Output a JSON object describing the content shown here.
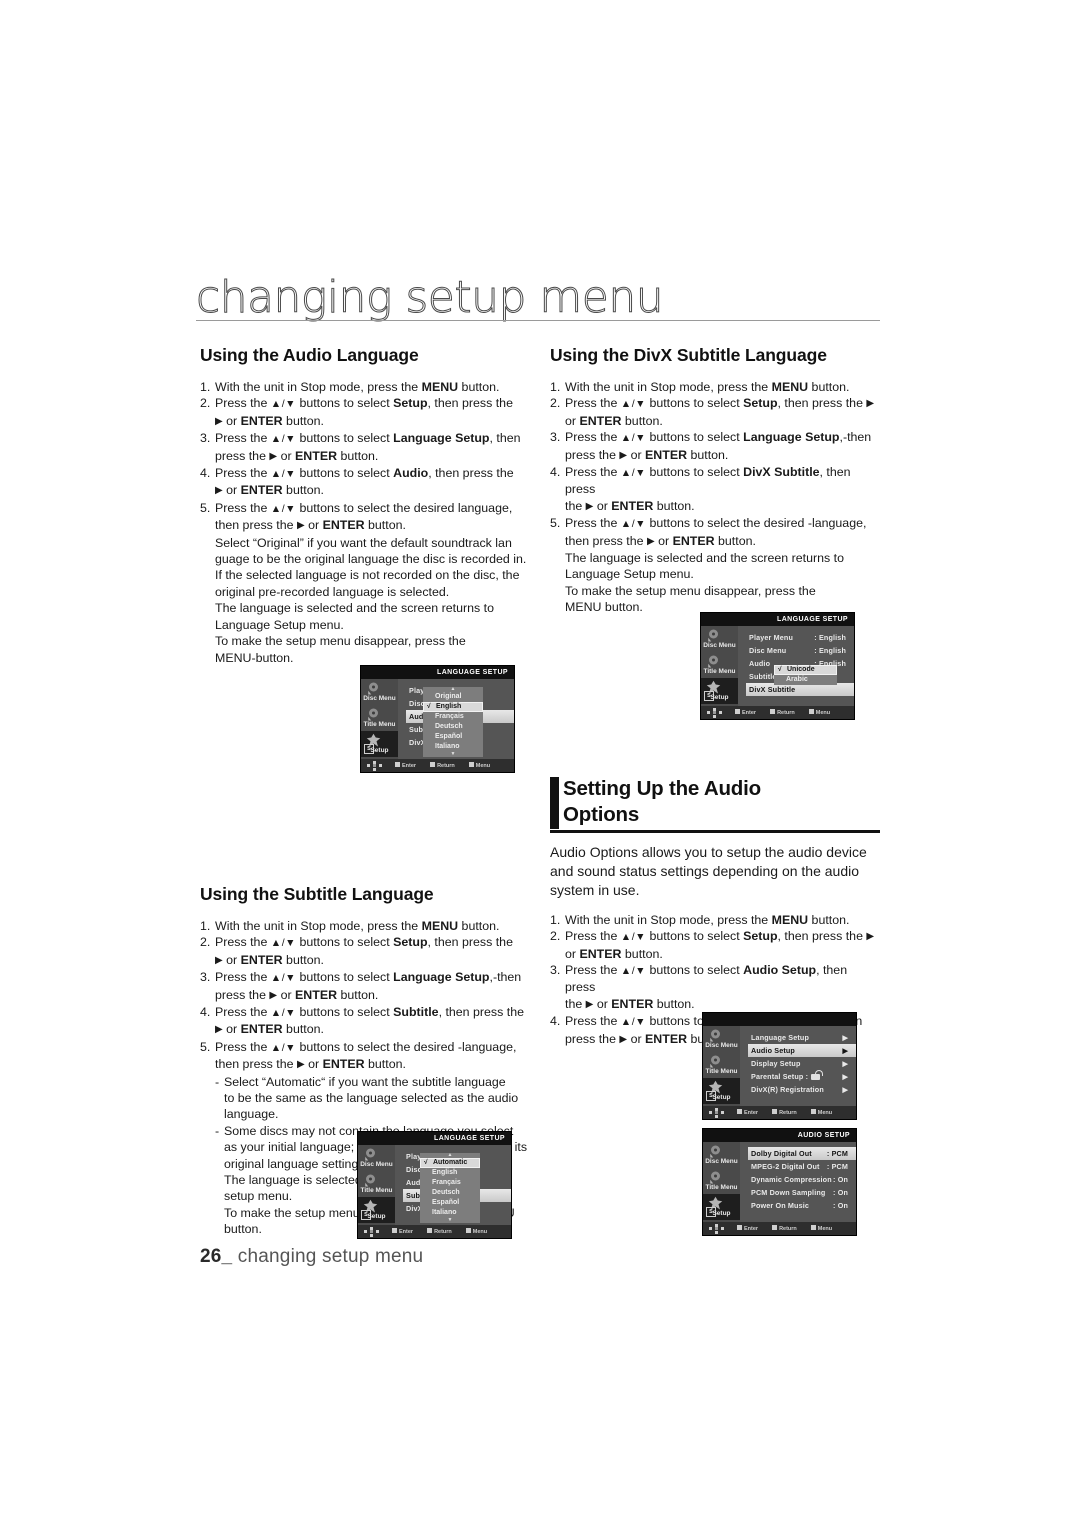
{
  "page": {
    "title": "changing setup menu",
    "footer_number": "26_",
    "footer_text": "changing setup menu"
  },
  "sections": {
    "audio_language": {
      "heading": "Using the Audio Language",
      "steps": [
        {
          "num": "1.",
          "html": "With the unit in Stop mode, press the <b>MENU</b> button."
        },
        {
          "num": "2.",
          "html": "Press the <span class=\"ud\">▲/▼</span> buttons to select <b>Setup</b>, then press the"
        },
        {
          "num": "",
          "cont": true,
          "html": "<span class=\"arr\">▶</span> or <b>ENTER</b> button."
        },
        {
          "num": "3.",
          "html": "Press the <span class=\"ud\">▲/▼</span> buttons to select <b>Language Setup</b>, then"
        },
        {
          "num": "",
          "cont": true,
          "html": "press the <span class=\"arr\">▶</span> or <b>ENTER</b> button."
        },
        {
          "num": "4.",
          "html": "Press the <span class=\"ud\">▲/▼</span> buttons to select <b>Audio</b>, then press the"
        },
        {
          "num": "",
          "cont": true,
          "html": "<span class=\"arr\">▶</span> or <b>ENTER</b> button."
        },
        {
          "num": "5.",
          "html": "Press the <span class=\"ud\">▲/▼</span> buttons to select the desired language,"
        },
        {
          "num": "",
          "cont": true,
          "html": "then press the <span class=\"arr\">▶</span> or <b>ENTER</b> button."
        },
        {
          "num": "",
          "cont": true,
          "html": "Select “Original” if you want the default soundtrack lan"
        },
        {
          "num": "",
          "cont": true,
          "html": "guage to be the original language the disc is recorded in."
        },
        {
          "num": "",
          "cont": true,
          "html": "If the selected language is not recorded on the disc, the"
        },
        {
          "num": "",
          "cont": true,
          "html": "original pre-recorded language is selected."
        },
        {
          "num": "",
          "cont": true,
          "html": "The language is selected and the screen returns to"
        },
        {
          "num": "",
          "cont": true,
          "html": "Language Setup menu."
        },
        {
          "num": "",
          "cont": true,
          "html": "To make the setup menu disappear, press the"
        },
        {
          "num": "",
          "cont": true,
          "html": "MENU-button."
        }
      ]
    },
    "subtitle_language": {
      "heading": "Using the Subtitle Language",
      "steps": [
        {
          "num": "1.",
          "html": "With the unit in Stop mode, press the <b>MENU</b> button."
        },
        {
          "num": "2.",
          "html": "Press the <span class=\"ud\">▲/▼</span> buttons to select <b>Setup</b>, then press the"
        },
        {
          "num": "",
          "cont": true,
          "html": "<span class=\"arr\">▶</span> or <b>ENTER</b> button."
        },
        {
          "num": "3.",
          "html": "Press the <span class=\"ud\">▲/▼</span> buttons to select <b>Language Setup</b>,-then"
        },
        {
          "num": "",
          "cont": true,
          "html": "press the <span class=\"arr\">▶</span> or <b>ENTER</b> button."
        },
        {
          "num": "4.",
          "html": "Press the <span class=\"ud\">▲/▼</span> buttons to select <b>Subtitle</b>, then press the"
        },
        {
          "num": "",
          "cont": true,
          "html": "<span class=\"arr\">▶</span> or <b>ENTER</b> button."
        },
        {
          "num": "5.",
          "html": "Press the <span class=\"ud\">▲/▼</span> buttons to select the desired -language,"
        },
        {
          "num": "",
          "cont": true,
          "html": "then press the <span class=\"arr\">▶</span> or <b>ENTER</b> button."
        },
        {
          "num": "-",
          "dash": true,
          "html": "Select “Automatic“ if you want the subtitle  language"
        },
        {
          "num": "",
          "cont2": true,
          "html": "to be the same as the language selected as the audio"
        },
        {
          "num": "",
          "cont2": true,
          "html": "language."
        },
        {
          "num": "-",
          "dash": true,
          "html": "Some discs may not contain the language you select"
        },
        {
          "num": "",
          "cont2": true,
          "html": "as your initial language; in that case the disc will use its"
        },
        {
          "num": "",
          "cont2": true,
          "html": "original language setting."
        },
        {
          "num": "",
          "cont2": true,
          "html": "The language is selected and the screen returns to"
        },
        {
          "num": "",
          "cont2": true,
          "html": "setup menu."
        },
        {
          "num": "",
          "cont2": true,
          "html": "To make the setup menu disappear, press the MENU"
        },
        {
          "num": "",
          "cont2": true,
          "html": "button."
        }
      ]
    },
    "divx_subtitle_language": {
      "heading": "Using the DivX Subtitle Language",
      "steps": [
        {
          "num": "1.",
          "html": "With the unit in Stop mode, press the <b>MENU</b> button."
        },
        {
          "num": "2.",
          "html": "Press the <span class=\"ud\">▲/▼</span> buttons to select <b>Setup</b>, then press the <span class=\"arr\">▶</span>"
        },
        {
          "num": "",
          "cont": true,
          "html": "or <b>ENTER</b> button."
        },
        {
          "num": "3.",
          "html": "Press the <span class=\"ud\">▲/▼</span> buttons to select <b>Language Setup</b>,-then"
        },
        {
          "num": "",
          "cont": true,
          "html": "press the <span class=\"arr\">▶</span> or <b>ENTER</b> button."
        },
        {
          "num": "4.",
          "html": "Press the <span class=\"ud\">▲/▼</span> buttons to select <b>DivX Subtitle</b>, then press"
        },
        {
          "num": "",
          "cont": true,
          "html": "the <span class=\"arr\">▶</span> or <b>ENTER</b> button."
        },
        {
          "num": "5.",
          "html": "Press the <span class=\"ud\">▲/▼</span> buttons to select the desired -language,"
        },
        {
          "num": "",
          "cont": true,
          "html": "then press the <span class=\"arr\">▶</span> or <b>ENTER</b> button."
        },
        {
          "num": "",
          "cont": true,
          "html": "The language is selected and the screen returns to"
        },
        {
          "num": "",
          "cont": true,
          "html": "Language Setup menu."
        },
        {
          "num": "",
          "cont": true,
          "html": "To make the setup menu disappear, press the"
        },
        {
          "num": "",
          "cont": true,
          "html": "MENU button."
        }
      ]
    },
    "audio_options": {
      "heading_line1": "Setting Up the Audio",
      "heading_line2": "Options",
      "intro": "Audio Options allows you to setup the audio device and sound status settings depending on the audio system in use.",
      "steps": [
        {
          "num": "1.",
          "html": "With the unit in Stop mode, press the <b>MENU</b> button."
        },
        {
          "num": "2.",
          "html": "Press the <span class=\"ud\">▲/▼</span> buttons to select <b>Setup</b>, then press the <span class=\"arr\">▶</span>"
        },
        {
          "num": "",
          "cont": true,
          "html": "or <b>ENTER</b> button."
        },
        {
          "num": "3.",
          "html": "Press the <span class=\"ud\">▲/▼</span> buttons to select <b>Audio Setup</b>, then press"
        },
        {
          "num": "",
          "cont": true,
          "html": "the <span class=\"arr\">▶</span> or <b>ENTER</b> button."
        },
        {
          "num": "4.",
          "html": "Press the <span class=\"ud\">▲/▼</span> buttons to select the desired item, then"
        },
        {
          "num": "",
          "cont": true,
          "html": "press the <span class=\"arr\">▶</span> or <b>ENTER</b> button."
        }
      ]
    }
  },
  "osd_common": {
    "sidebar": [
      {
        "label": "Disc Menu",
        "icon": "disc-menu-icon"
      },
      {
        "label": "Title Menu",
        "icon": "title-menu-icon"
      },
      {
        "label": "Setup",
        "icon": "setup-icon",
        "badge": "S"
      }
    ],
    "footer": [
      {
        "label": "Enter"
      },
      {
        "label": "Return"
      },
      {
        "label": "Menu"
      }
    ]
  },
  "osd_screens": {
    "audio_language": {
      "title": "LANGUAGE SETUP",
      "rows": [
        {
          "name": "Player Menu",
          "value": "",
          "selected": false
        },
        {
          "name": "Disc Menu",
          "value": "",
          "selected": false
        },
        {
          "name": "Audio",
          "value": "",
          "selected": true
        },
        {
          "name": "Subtitle",
          "value": "",
          "selected": false
        },
        {
          "name": "DivX Subtitle",
          "value": "",
          "selected": false
        }
      ],
      "popup": {
        "up_arrow": "▲",
        "down_arrow": "▼",
        "items": [
          {
            "label": "Original",
            "checked": false,
            "selected": false
          },
          {
            "label": "English",
            "checked": true,
            "selected": true
          },
          {
            "label": "Français",
            "checked": false,
            "selected": false
          },
          {
            "label": "Deutsch",
            "checked": false,
            "selected": false
          },
          {
            "label": "Español",
            "checked": false,
            "selected": false
          },
          {
            "label": "Italiano",
            "checked": false,
            "selected": false
          }
        ]
      }
    },
    "divx_subtitle": {
      "title": "LANGUAGE SETUP",
      "rows": [
        {
          "name": "Player Menu",
          "value": ": English",
          "selected": false
        },
        {
          "name": "Disc Menu",
          "value": ": English",
          "selected": false
        },
        {
          "name": "Audio",
          "value": ": English",
          "selected": false
        },
        {
          "name": "Subtitle",
          "value": "",
          "selected": false
        },
        {
          "name": "DivX Subtitle",
          "value": "",
          "selected": true
        }
      ],
      "popup": {
        "items": [
          {
            "label": "Unicode",
            "checked": true,
            "selected": true
          },
          {
            "label": "Arabic",
            "checked": false,
            "selected": false
          }
        ]
      }
    },
    "subtitle_language": {
      "title": "LANGUAGE SETUP",
      "rows": [
        {
          "name": "Player Menu",
          "value": "",
          "selected": false
        },
        {
          "name": "Disc Menu",
          "value": "",
          "selected": false
        },
        {
          "name": "Audio",
          "value": "",
          "selected": false
        },
        {
          "name": "Subtitle",
          "value": "",
          "selected": true
        },
        {
          "name": "DivX Subtitle",
          "value": "",
          "selected": false
        }
      ],
      "popup": {
        "up_arrow": "▲",
        "down_arrow": "▼",
        "items": [
          {
            "label": "Automatic",
            "checked": true,
            "selected": true
          },
          {
            "label": "English",
            "checked": false,
            "selected": false
          },
          {
            "label": "Français",
            "checked": false,
            "selected": false
          },
          {
            "label": "Deutsch",
            "checked": false,
            "selected": false
          },
          {
            "label": "Español",
            "checked": false,
            "selected": false
          },
          {
            "label": "Italiano",
            "checked": false,
            "selected": false
          }
        ]
      }
    },
    "setup_menu": {
      "title": "",
      "rows": [
        {
          "name": "Language Setup",
          "value": "▶",
          "selected": false
        },
        {
          "name": "Audio Setup",
          "value": "▶",
          "selected": true
        },
        {
          "name": "Display Setup",
          "value": "▶",
          "selected": false
        },
        {
          "name": "Parental Setup :",
          "value": "▶",
          "selected": false,
          "lock": true
        },
        {
          "name": "DivX(R) Registration",
          "value": "▶",
          "selected": false
        }
      ]
    },
    "audio_setup": {
      "title": "AUDIO SETUP",
      "rows": [
        {
          "name": "Dolby Digital Out",
          "value": ": PCM",
          "selected": true
        },
        {
          "name": "MPEG-2 Digital Out",
          "value": ": PCM",
          "selected": false
        },
        {
          "name": "Dynamic Compression",
          "value": ": On",
          "selected": false
        },
        {
          "name": "PCM Down Sampling",
          "value": ": On",
          "selected": false
        },
        {
          "name": "Power On Music",
          "value": ": On",
          "selected": false
        }
      ]
    }
  },
  "colors": {
    "ink": "#1a1a1a",
    "rule": "#9a9a9a",
    "osd_bg": "#555555",
    "osd_title_bg": "#111111",
    "accent_bar": "#111111"
  }
}
